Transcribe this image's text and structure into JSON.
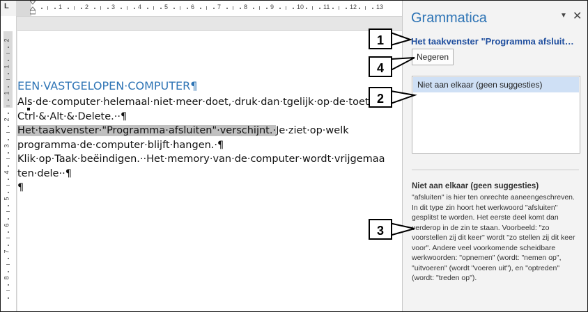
{
  "ruler": {
    "corner_glyph": "L",
    "h_numbers": [
      "1",
      "2",
      "3",
      "4",
      "5",
      "6",
      "7",
      "8",
      "9",
      "10",
      "11",
      "12",
      "13"
    ],
    "v_numbers": [
      "2",
      "1",
      "1",
      "2",
      "3",
      "4",
      "5",
      "6",
      "7",
      "8"
    ]
  },
  "document": {
    "heading": "EEN·VASTGELOPEN·COMPUTER¶",
    "lines": [
      "Als·de·computer·helemaal·niet·meer·doet,·druk·dan·tgelijk·op·de·toetsen",
      "Ctrl·&·Alt·&·Delete.··¶"
    ],
    "highlight_text": "Het·taakvenster·\"Programma·afsluiten\"·verschijnt.·",
    "highlight_tail": "Je·ziet·op·welk",
    "lines_after": [
      "programma·de·computer·blijft·hangen.·¶",
      "Klik·op·Taak·beëindigen.··Het·memory·van·de·computer·wordt·vrijgemaakt",
      "ten·dele··¶",
      "¶"
    ]
  },
  "pane": {
    "title": "Grammatica",
    "menu_glyph": "▼",
    "close_glyph": "✕",
    "sentence": "Het taakvenster \"Programma afsluiten\" verschijnt.",
    "ignore_label": "Negeren",
    "suggestion": "Niet aan elkaar (geen suggesties)",
    "explanation_title": "Niet aan elkaar (geen suggesties)",
    "explanation": "\"afsluiten\" is hier ten onrechte aaneengeschreven. In dit type zin hoort het werkwoord \"afsluiten\" gesplitst te worden. Het eerste deel komt dan verderop in de zin te staan. Voorbeeld: \"zo voorstellen zij dit keer\" wordt \"zo stellen zij dit keer voor\". Andere veel voorkomende scheidbare werkwoorden: \"opnemen\" (wordt: \"nemen op\", \"uitvoeren\" (wordt \"voeren uit\"), en \"optreden\" (wordt: \"treden op\")."
  },
  "callouts": [
    "1",
    "4",
    "2",
    "3"
  ]
}
